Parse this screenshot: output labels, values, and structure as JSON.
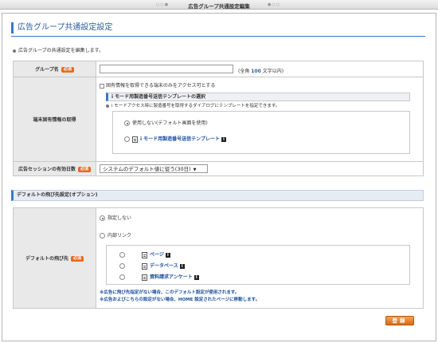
{
  "window": {
    "title": "広告グループ共通設定編集",
    "dots_left": "○○●",
    "dots_right": "●○○"
  },
  "page": {
    "title": "広告グループ共通設定設定",
    "description": "広告グループの共通設定を編集します。"
  },
  "required_label": "必須",
  "group_name": {
    "label": "グループ名",
    "value": "",
    "hint_prefix": "(全角 ",
    "hint_count": "100",
    "hint_suffix": " 文字以内)"
  },
  "terminal": {
    "label": "端末固有情報の取得",
    "checkbox_label": "固有情報を取得できる端末のみをアクセス可とする",
    "template_head": "i モード用製造番号送信テンプレートの選択",
    "template_desc": "i モードアクセス時に製造番号を取得するダイアログにテンプレートを指定できます。",
    "options": [
      {
        "label": "使用しない(デフォルト画面を使用)",
        "checked": true
      },
      {
        "label": "i モード用製造番号送信テンプレート",
        "checked": false
      }
    ],
    "info_glyph": "i"
  },
  "session": {
    "label": "広告セッションの有効日数",
    "selected": "システムのデフォルト値に従う(30日)"
  },
  "default_dest": {
    "section_title": "デフォルトの飛び先設定(オプション)",
    "label": "デフォルトの飛び先",
    "options": [
      {
        "label": "指定しない",
        "checked": true
      },
      {
        "label": "内部リンク",
        "checked": false
      }
    ],
    "links": [
      {
        "label": "ページ"
      },
      {
        "label": "データベース"
      },
      {
        "label": "資料請求アンケート"
      }
    ],
    "notes": [
      "※広告に飛び先指定がない場合、このデフォルト設定が使用されます。",
      "※広告およびこちらの設定がない場合、HOME 設定されたページに移動します。"
    ]
  },
  "submit_label": "登録"
}
